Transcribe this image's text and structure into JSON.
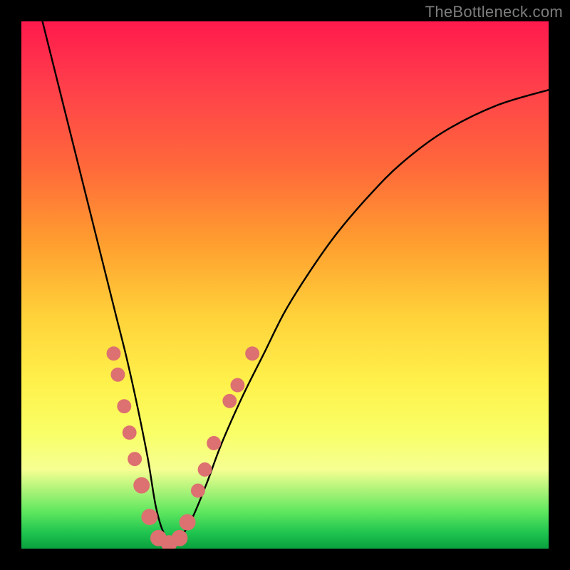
{
  "watermark": "TheBottleneck.com",
  "chart_data": {
    "type": "line",
    "title": "",
    "xlabel": "",
    "ylabel": "",
    "xlim": [
      0,
      100
    ],
    "ylim": [
      0,
      100
    ],
    "grid": false,
    "series": [
      {
        "name": "curve",
        "x": [
          4,
          6,
          8,
          10,
          12,
          14,
          16,
          18,
          20,
          22,
          24,
          25.5,
          27,
          29,
          32,
          35,
          38,
          42,
          46,
          50,
          55,
          60,
          66,
          72,
          80,
          90,
          100
        ],
        "values": [
          100,
          92,
          84,
          76,
          68,
          60,
          52,
          44,
          36,
          27,
          17,
          8,
          3,
          1,
          5,
          12,
          20,
          29,
          37,
          45,
          53,
          60,
          67,
          73,
          79,
          84,
          87
        ]
      }
    ],
    "markers": [
      {
        "x": 17.5,
        "y": 37,
        "r": 1.2
      },
      {
        "x": 18.3,
        "y": 33,
        "r": 1.2
      },
      {
        "x": 19.5,
        "y": 27,
        "r": 1.2
      },
      {
        "x": 20.5,
        "y": 22,
        "r": 1.2
      },
      {
        "x": 21.5,
        "y": 17,
        "r": 1.2
      },
      {
        "x": 22.8,
        "y": 12,
        "r": 1.6
      },
      {
        "x": 24.3,
        "y": 6,
        "r": 1.6
      },
      {
        "x": 26.0,
        "y": 2,
        "r": 1.6
      },
      {
        "x": 28.0,
        "y": 1,
        "r": 1.6
      },
      {
        "x": 30.0,
        "y": 2,
        "r": 1.6
      },
      {
        "x": 31.5,
        "y": 5,
        "r": 1.6
      },
      {
        "x": 33.5,
        "y": 11,
        "r": 1.2
      },
      {
        "x": 34.8,
        "y": 15,
        "r": 1.2
      },
      {
        "x": 36.5,
        "y": 20,
        "r": 1.2
      },
      {
        "x": 39.5,
        "y": 28,
        "r": 1.2
      },
      {
        "x": 41.0,
        "y": 31,
        "r": 1.2
      },
      {
        "x": 43.8,
        "y": 37,
        "r": 1.2
      }
    ]
  }
}
